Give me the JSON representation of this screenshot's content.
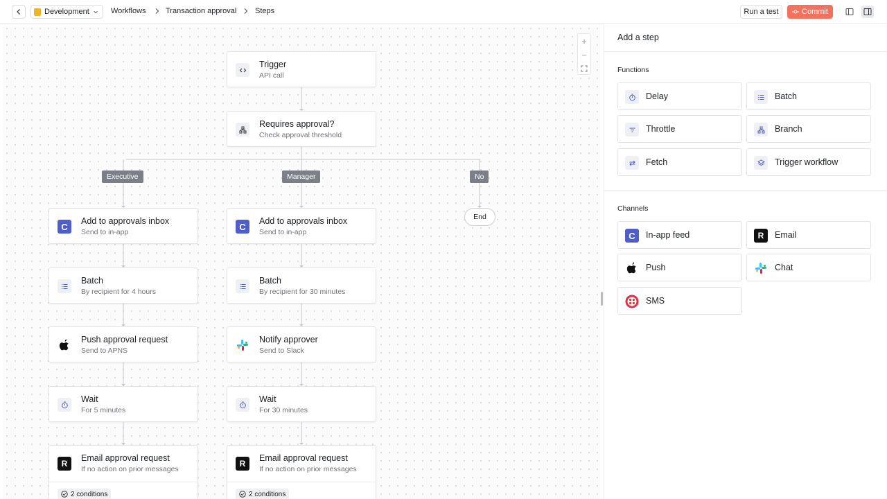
{
  "header": {
    "environment": "Development",
    "breadcrumbs": [
      "Workflows",
      "Transaction approval",
      "Steps"
    ],
    "run_test_label": "Run a test",
    "commit_label": "Commit"
  },
  "canvas": {
    "trigger": {
      "title": "Trigger",
      "subtitle": "API call"
    },
    "branch_node": {
      "title": "Requires approval?",
      "subtitle": "Check approval threshold"
    },
    "branch_tags": [
      "Executive",
      "Manager",
      "No"
    ],
    "end_label": "End",
    "executive_steps": [
      {
        "title": "Add to approvals inbox",
        "subtitle": "Send to in-app"
      },
      {
        "title": "Batch",
        "subtitle": "By recipient for 4 hours"
      },
      {
        "title": "Push approval request",
        "subtitle": "Send to APNS"
      },
      {
        "title": "Wait",
        "subtitle": "For 5 minutes"
      },
      {
        "title": "Email approval request",
        "subtitle": "If no action on prior messages",
        "conditions": "2 conditions"
      }
    ],
    "manager_steps": [
      {
        "title": "Add to approvals inbox",
        "subtitle": "Send to in-app"
      },
      {
        "title": "Batch",
        "subtitle": "By recipient for 30 minutes"
      },
      {
        "title": "Notify approver",
        "subtitle": "Send to Slack"
      },
      {
        "title": "Wait",
        "subtitle": "For 30 minutes"
      },
      {
        "title": "Email approval request",
        "subtitle": "If no action on prior messages",
        "conditions": "2 conditions"
      }
    ]
  },
  "panel": {
    "title": "Add a step",
    "functions_label": "Functions",
    "functions": [
      {
        "label": "Delay",
        "icon": "timer-icon"
      },
      {
        "label": "Batch",
        "icon": "list-icon"
      },
      {
        "label": "Throttle",
        "icon": "filter-icon"
      },
      {
        "label": "Branch",
        "icon": "branch-icon"
      },
      {
        "label": "Fetch",
        "icon": "arrows-icon"
      },
      {
        "label": "Trigger workflow",
        "icon": "layers-icon"
      }
    ],
    "channels_label": "Channels",
    "channels": [
      {
        "label": "In-app feed",
        "icon": "in-app-icon"
      },
      {
        "label": "Email",
        "icon": "resend-icon"
      },
      {
        "label": "Push",
        "icon": "apple-icon"
      },
      {
        "label": "Chat",
        "icon": "slack-icon"
      },
      {
        "label": "SMS",
        "icon": "twilio-icon"
      }
    ]
  },
  "colors": {
    "accent": "#f2725e",
    "brand": "#4f5ec9",
    "tag": "#7c7f87"
  }
}
